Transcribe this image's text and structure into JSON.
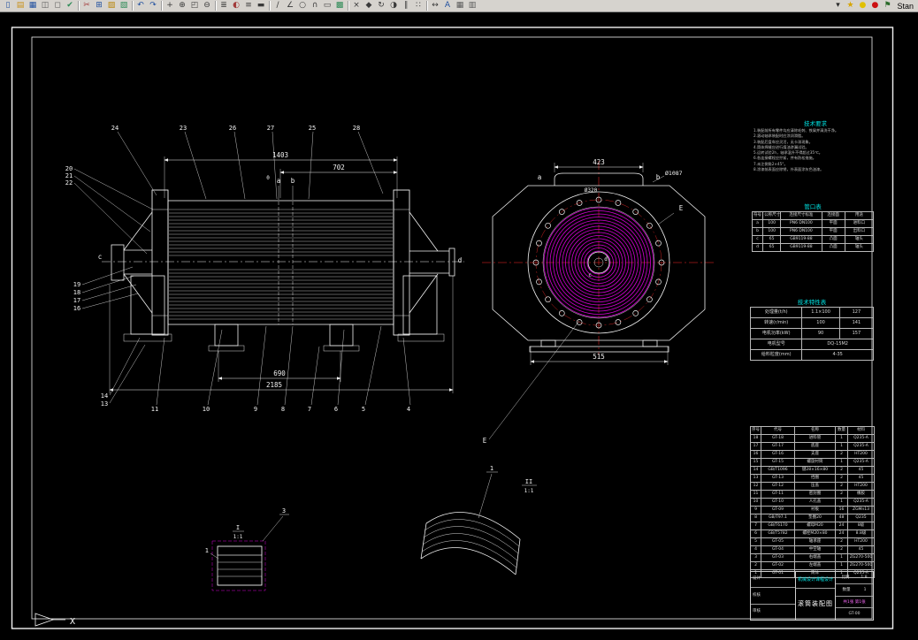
{
  "window": {
    "toolbar": {
      "toolbar_label": "Stan",
      "icons": [
        {
          "name": "new-icon",
          "glyph": "▯",
          "color": "#1f4f9f"
        },
        {
          "name": "open-icon",
          "glyph": "▤",
          "color": "#c89018"
        },
        {
          "name": "save-icon",
          "glyph": "▦",
          "color": "#1f4f9f"
        },
        {
          "name": "plot-icon",
          "glyph": "◫",
          "color": "#5a5a5a"
        },
        {
          "name": "preview-icon",
          "glyph": "◻",
          "color": "#5a5a5a"
        },
        {
          "name": "spell-icon",
          "glyph": "✔",
          "color": "#2e8b57"
        },
        {
          "sep": true
        },
        {
          "name": "cut-icon",
          "glyph": "✂",
          "color": "#a23b3b"
        },
        {
          "name": "copy-icon",
          "glyph": "⊞",
          "color": "#1f4f9f"
        },
        {
          "name": "paste-icon",
          "glyph": "▨",
          "color": "#b8860b"
        },
        {
          "name": "match-properties-icon",
          "glyph": "▧",
          "color": "#2e8b57"
        },
        {
          "sep": true
        },
        {
          "name": "undo-icon",
          "glyph": "↶",
          "color": "#1f4f9f"
        },
        {
          "name": "redo-icon",
          "glyph": "↷",
          "color": "#1f4f9f"
        },
        {
          "sep": true
        },
        {
          "name": "pan-icon",
          "glyph": "+",
          "color": "#3a3a3a"
        },
        {
          "name": "zoom-realtime-icon",
          "glyph": "⊕",
          "color": "#3a3a3a"
        },
        {
          "name": "zoom-window-icon",
          "glyph": "◰",
          "color": "#3a3a3a"
        },
        {
          "name": "zoom-out-icon",
          "glyph": "⊖",
          "color": "#3a3a3a"
        },
        {
          "sep": true
        },
        {
          "name": "layers-icon",
          "glyph": "≣",
          "color": "#3a3a3a"
        },
        {
          "name": "layer-color-icon",
          "glyph": "◐",
          "color": "#a23b3b"
        },
        {
          "name": "linetype-icon",
          "glyph": "≡",
          "color": "#3a3a3a"
        },
        {
          "name": "lineweight-icon",
          "glyph": "▬",
          "color": "#3a3a3a"
        },
        {
          "sep": true
        },
        {
          "name": "line-icon",
          "glyph": "∕",
          "color": "#3a3a3a"
        },
        {
          "name": "polyline-icon",
          "glyph": "∠",
          "color": "#3a3a3a"
        },
        {
          "name": "circle-icon",
          "glyph": "○",
          "color": "#3a3a3a"
        },
        {
          "name": "arc-icon",
          "glyph": "∩",
          "color": "#3a3a3a"
        },
        {
          "name": "rectangle-icon",
          "glyph": "▭",
          "color": "#3a3a3a"
        },
        {
          "name": "hatch-icon",
          "glyph": "▩",
          "color": "#2e8b57"
        },
        {
          "sep": true
        },
        {
          "name": "erase-icon",
          "glyph": "×",
          "color": "#3a3a3a"
        },
        {
          "name": "move-icon",
          "glyph": "◆",
          "color": "#3a3a3a"
        },
        {
          "name": "rotate-icon",
          "glyph": "↻",
          "color": "#3a3a3a"
        },
        {
          "name": "mirror-icon",
          "glyph": "◑",
          "color": "#3a3a3a"
        },
        {
          "name": "offset-icon",
          "glyph": "∥",
          "color": "#3a3a3a"
        },
        {
          "name": "array-icon",
          "glyph": "∷",
          "color": "#3a3a3a"
        },
        {
          "sep": true
        },
        {
          "name": "dimension-icon",
          "glyph": "↔",
          "color": "#3a3a3a"
        },
        {
          "name": "text-icon",
          "glyph": "A",
          "color": "#1f4f9f"
        },
        {
          "name": "table-icon",
          "glyph": "▦",
          "color": "#5a5a5a"
        },
        {
          "name": "properties-icon",
          "glyph": "▥",
          "color": "#5a5a5a"
        }
      ],
      "right_icons": [
        {
          "name": "dropdown-arrow-icon",
          "glyph": "▾",
          "color": "#2a2a2a"
        },
        {
          "name": "style-icon",
          "glyph": "★",
          "color": "#d7a500"
        },
        {
          "name": "bulb-icon",
          "glyph": "●",
          "color": "#e0c000"
        },
        {
          "name": "record-icon",
          "glyph": "●",
          "color": "#cc1111"
        },
        {
          "name": "flag-icon",
          "glyph": "⚑",
          "color": "#2a6a2a"
        }
      ]
    }
  },
  "drawing": {
    "front_view": {
      "dim_1403": "1403",
      "dim_702": "702",
      "dim_690": "690",
      "dim_2185": "2185",
      "mark_zero": "0",
      "label_a": "a",
      "label_b": "b",
      "label_c": "c",
      "label_d": "d",
      "balloons_top": [
        "24",
        "23",
        "26",
        "27",
        "25",
        "28"
      ],
      "balloons_left_upper": [
        "20",
        "21",
        "22"
      ],
      "balloons_left_mid": [
        "19",
        "18",
        "17",
        "16"
      ],
      "balloons_left_lower": [
        "14",
        "13"
      ],
      "balloons_bottom": [
        "11",
        "10",
        "9",
        "8",
        "7",
        "6",
        "5",
        "4"
      ]
    },
    "end_view": {
      "dim_423": "423",
      "dim_515": "515",
      "dim_d320": "Ø320",
      "dim_d1087": "Ø1087",
      "label_a": "a",
      "label_b": "b",
      "label_c": "c",
      "label_d": "d",
      "label_e": "E"
    },
    "details": {
      "detail_i": {
        "num": "1",
        "balloon": "3",
        "name": "I",
        "scale": "1:1"
      },
      "detail_ii": {
        "balloon": "1",
        "name": "II",
        "scale": "1:1",
        "section_label": "E"
      }
    },
    "axis_label": "X",
    "notes": {
      "title": "技术要求",
      "lines": [
        "1.装配前所有零件均应清除毛刺、铁屑并清洗干净。",
        "2.滚动轴承装配时应涂润滑脂。",
        "3.装配后盘车应灵活，无卡滞现象。",
        "4.筒体焊缝应进行煤油渗漏试验。",
        "5.运转试验2h，轴承温升不得超过35℃。",
        "6.各连接螺栓应拧紧，并有防松措施。",
        "7.未注倒角2×45°。",
        "8.涂漆前表面应除锈，外表面涂灰色油漆。"
      ]
    },
    "nozzle_table": {
      "title": "管口表",
      "headers": [
        "符号",
        "公称尺寸",
        "连接尺寸标准",
        "连接面",
        "用途"
      ],
      "rows": [
        [
          "a",
          "100",
          "PN6 DN100",
          "平面",
          "进料口"
        ],
        [
          "b",
          "100",
          "PN6 DN100",
          "平面",
          "出料口"
        ],
        [
          "c",
          "65",
          "GB9119-88",
          "凸面",
          "轴头"
        ],
        [
          "d",
          "65",
          "GB9119-88",
          "凸面",
          "轴头"
        ]
      ]
    },
    "tech_table": {
      "title": "技术特性表",
      "rows": [
        [
          "处理量(t/h)",
          "1.1×100",
          "127"
        ],
        [
          "转速(r/min)",
          "100",
          "141"
        ],
        [
          "电机功率(kW)",
          "90",
          "157"
        ],
        [
          "电机型号",
          "DQ-15M2",
          ""
        ],
        [
          "给料粒度(mm)",
          "4-35",
          ""
        ]
      ]
    },
    "parts_table": {
      "headers": [
        "序号",
        "代号",
        "名称",
        "数量",
        "材料"
      ],
      "rows": [
        [
          "18",
          "GT-18",
          "进料管",
          "1",
          "Q235-A"
        ],
        [
          "17",
          "GT-17",
          "底座",
          "1",
          "Q235-A"
        ],
        [
          "16",
          "GT-16",
          "支座",
          "2",
          "HT200"
        ],
        [
          "15",
          "GT-15",
          "螺旋衬筒",
          "1",
          "Q235-A"
        ],
        [
          "14",
          "GB/T1096",
          "键28×16×80",
          "2",
          "45"
        ],
        [
          "13",
          "GT-13",
          "挡圈",
          "2",
          "45"
        ],
        [
          "12",
          "GT-12",
          "压盖",
          "2",
          "HT200"
        ],
        [
          "11",
          "GT-11",
          "密封圈",
          "2",
          "橡胶"
        ],
        [
          "10",
          "GT-10",
          "人孔盖",
          "1",
          "Q235-A"
        ],
        [
          "9",
          "GT-09",
          "衬板",
          "16",
          "ZGMn13"
        ],
        [
          "8",
          "GB/T97.1",
          "垫圈20",
          "48",
          "Q235"
        ],
        [
          "7",
          "GB/T6170",
          "螺母M20",
          "24",
          "8级"
        ],
        [
          "6",
          "GB/T5782",
          "螺栓M20×80",
          "24",
          "8.8级"
        ],
        [
          "5",
          "GT-05",
          "轴承座",
          "2",
          "HT200"
        ],
        [
          "4",
          "GT-04",
          "中空轴",
          "2",
          "45"
        ],
        [
          "3",
          "GT-03",
          "右端盖",
          "1",
          "ZG270-500"
        ],
        [
          "2",
          "GT-02",
          "左端盖",
          "1",
          "ZG270-500"
        ],
        [
          "1",
          "GT-01",
          "筒体",
          "1",
          "Q235-A"
        ]
      ]
    },
    "title_block": {
      "company": "机械设计课程设计",
      "title": "滚筒装配图",
      "drawing_no": "GT-00",
      "scale_label": "比例",
      "scale": "1:8",
      "qty_label": "数量",
      "qty": "1",
      "sheet": "共1张 第1张",
      "fields": [
        "设计",
        "校核",
        "审核"
      ]
    }
  }
}
